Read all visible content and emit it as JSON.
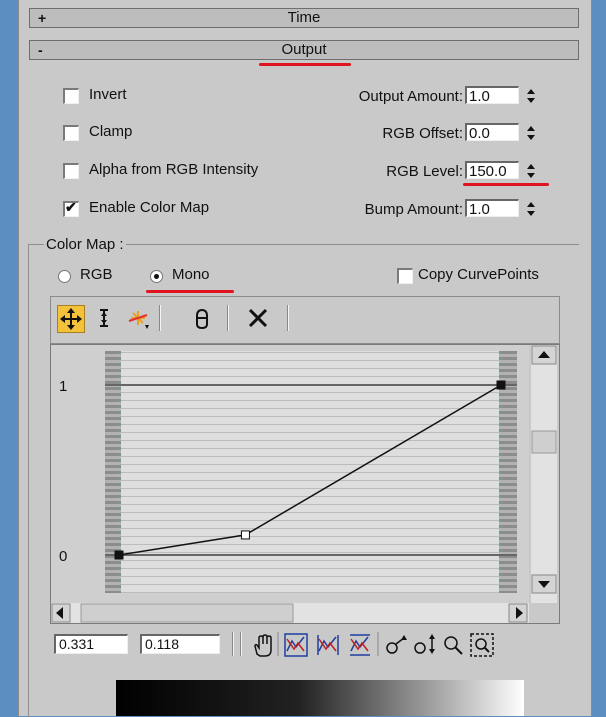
{
  "rollouts": {
    "time": {
      "sign": "+",
      "title": "Time"
    },
    "output": {
      "sign": "-",
      "title": "Output"
    }
  },
  "options": {
    "invert": {
      "label": "Invert",
      "checked": false
    },
    "clamp": {
      "label": "Clamp",
      "checked": false
    },
    "alpha_from_rgb": {
      "label": "Alpha from RGB Intensity",
      "checked": false
    },
    "enable_color_map": {
      "label": "Enable Color Map",
      "checked": true,
      "mark": "✔"
    }
  },
  "parameters": {
    "output_amount": {
      "label": "Output Amount:",
      "value": "1.0"
    },
    "rgb_offset": {
      "label": "RGB Offset:",
      "value": "0.0"
    },
    "rgb_level": {
      "label": "RGB Level:",
      "value": "150.0"
    },
    "bump_amount": {
      "label": "Bump Amount:",
      "value": "1.0"
    }
  },
  "color_map": {
    "group_label": "Color Map :",
    "mode_rgb": {
      "label": "RGB",
      "selected": false
    },
    "mode_mono": {
      "label": "Mono",
      "selected": true
    },
    "copy_curve_points": {
      "label": "Copy CurvePoints",
      "checked": false
    },
    "toolbar": [
      "move-icon",
      "scale-point-icon",
      "add-point-icon",
      "reset-curves-icon",
      "delete-point-icon"
    ],
    "curve": {
      "y_axis_labels": [
        "1",
        "0"
      ],
      "points": [
        {
          "x": 0.0,
          "y": 0.0,
          "type": "corner"
        },
        {
          "x": 0.331,
          "y": 0.118,
          "type": "bezier"
        },
        {
          "x": 1.0,
          "y": 1.0,
          "type": "corner"
        }
      ]
    },
    "coords": {
      "x": "0.331",
      "y": "0.118"
    },
    "view_tools": [
      "pan-icon",
      "zoom-extents-icon",
      "zoom-horizontal-extents-icon",
      "zoom-value-extents-icon",
      "zoom-horizontal-icon",
      "zoom-vertical-icon",
      "zoom-icon",
      "zoom-region-icon"
    ]
  },
  "colors": {
    "accent_red": "#e0141e",
    "highlight": "#f4c23a",
    "curve": "#111111"
  }
}
